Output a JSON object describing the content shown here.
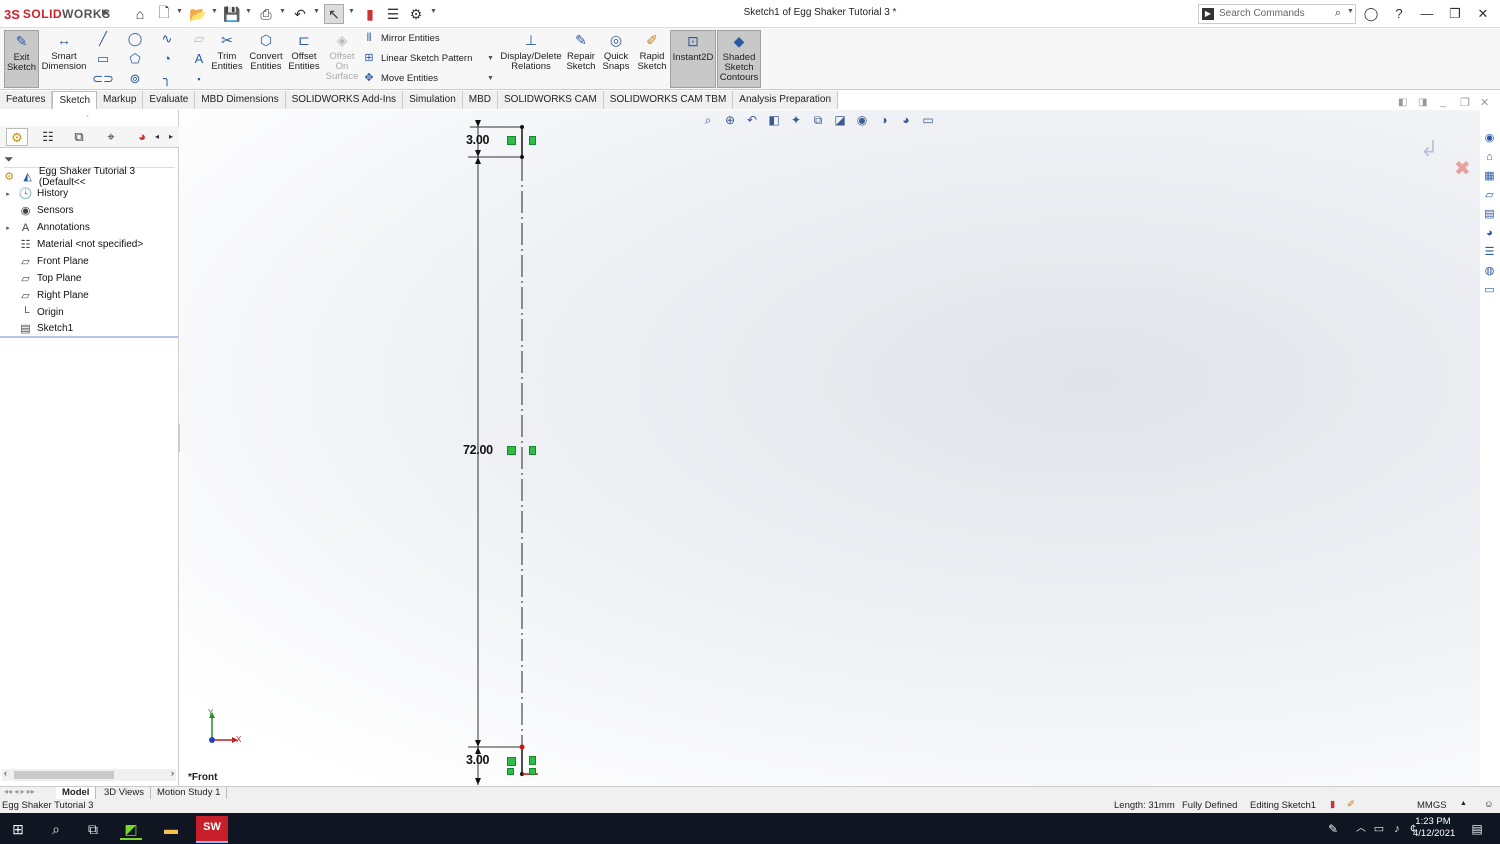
{
  "app": {
    "brand_ds": "3S",
    "brand_name_solid": "SOLID",
    "brand_name_works": "WORKS"
  },
  "window": {
    "title": "Sketch1 of Egg Shaker Tutorial 3 *"
  },
  "search": {
    "placeholder": "Search Commands"
  },
  "ribbon": {
    "exit_sketch": "Exit\nSketch",
    "smart_dimension": "Smart\nDimension",
    "trim_entities": "Trim\nEntities",
    "convert_entities": "Convert\nEntities",
    "offset_entities": "Offset\nEntities",
    "offset_on_surface": "Offset\nOn\nSurface",
    "mirror_entities": "Mirror Entities",
    "linear_sketch_pattern": "Linear Sketch Pattern",
    "move_entities": "Move Entities",
    "display_delete_relations": "Display/Delete\nRelations",
    "repair_sketch": "Repair\nSketch",
    "quick_snaps": "Quick\nSnaps",
    "rapid_sketch": "Rapid\nSketch",
    "instant2d": "Instant2D",
    "shaded_sketch_contours": "Shaded\nSketch\nContours"
  },
  "tabs": [
    "Features",
    "Sketch",
    "Markup",
    "Evaluate",
    "MBD Dimensions",
    "SOLIDWORKS Add-Ins",
    "Simulation",
    "MBD",
    "SOLIDWORKS CAM",
    "SOLIDWORKS CAM TBM",
    "Analysis Preparation"
  ],
  "active_tab": "Sketch",
  "tree": {
    "root": "Egg Shaker Tutorial 3  (Default<<",
    "items": [
      "History",
      "Sensors",
      "Annotations",
      "Material <not specified>",
      "Front Plane",
      "Top Plane",
      "Right Plane",
      "Origin",
      "Sketch1"
    ]
  },
  "sketch": {
    "dims": [
      "3.00",
      "72.00",
      "3.00"
    ],
    "view_label": "*Front",
    "axis_x": "X",
    "axis_y": "Y"
  },
  "bottom_tabs": [
    "Model",
    "3D Views",
    "Motion Study 1"
  ],
  "status": {
    "left": "Egg Shaker Tutorial 3",
    "length": "Length: 31mm",
    "defined": "Fully Defined",
    "editing": "Editing Sketch1",
    "units": "MMGS"
  },
  "taskbar": {
    "time": "1:23 PM",
    "date": "4/12/2021"
  },
  "colors": {
    "brand": "#d0202c",
    "relation": "#2ebd47",
    "taskbar": "#101522"
  }
}
